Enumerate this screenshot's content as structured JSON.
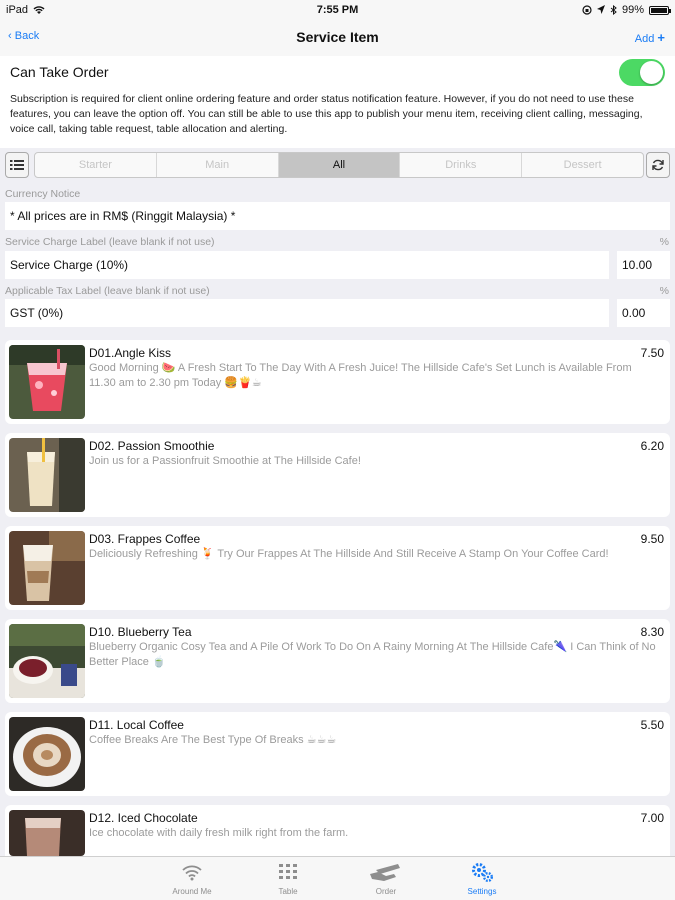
{
  "status_bar": {
    "carrier": "iPad",
    "time": "7:55 PM",
    "battery": "99%",
    "battery_level": 0.99
  },
  "nav": {
    "back_label": "Back",
    "title": "Service Item",
    "add_label": "Add"
  },
  "order": {
    "label": "Can Take Order",
    "enabled": true
  },
  "subscription_note": "Subscription is required for client online ordering feature and order status notification feature. However, if you do not need to use these features, you can leave the option off. You can still be able to use this app to publish your menu item, receiving client calling, messaging, voice call, taking table request, table allocation and alerting.",
  "segments": [
    {
      "label": "Starter",
      "active": false
    },
    {
      "label": "Main",
      "active": false
    },
    {
      "label": "All",
      "active": true
    },
    {
      "label": "Drinks",
      "active": false
    },
    {
      "label": "Dessert",
      "active": false
    }
  ],
  "currency": {
    "label": "Currency Notice",
    "value": "* All prices are in RM$ (Ringgit Malaysia) *"
  },
  "service_charge": {
    "label": "Service Charge Label (leave blank if not use)",
    "value": "Service Charge (10%)",
    "percent_symbol": "%",
    "percent_value": "10.00"
  },
  "tax": {
    "label": "Applicable Tax Label (leave blank if not use)",
    "value": "GST (0%)",
    "percent_symbol": "%",
    "percent_value": "0.00"
  },
  "items": [
    {
      "name": "D01.Angle Kiss",
      "price": "7.50",
      "description": "Good Morning 🍉 A Fresh Start To The Day With A Fresh Juice! The Hillside Cafe's Set Lunch is Available From 11.30 am to 2.30 pm Today 🍔🍟☕"
    },
    {
      "name": "D02. Passion Smoothie",
      "price": "6.20",
      "description": "Join us for a Passionfruit Smoothie at The Hillside Cafe!"
    },
    {
      "name": "D03. Frappes Coffee",
      "price": "9.50",
      "description": "Deliciously Refreshing 🍹 Try Our Frappes At The Hillside And Still Receive A Stamp On Your Coffee Card!"
    },
    {
      "name": "D10. Blueberry Tea",
      "price": "8.30",
      "description": "Blueberry Organic Cosy Tea and A Pile Of Work To Do On A Rainy Morning At The Hillside Cafe🌂 I Can Think of No Better Place 🍵"
    },
    {
      "name": "D11. Local Coffee",
      "price": "5.50",
      "description": "Coffee Breaks Are The Best Type Of Breaks ☕☕☕"
    },
    {
      "name": "D12. Iced Chocolate",
      "price": "7.00",
      "description": "Ice chocolate with daily fresh milk right from the farm."
    }
  ],
  "tabs": [
    {
      "label": "Around Me",
      "icon": "wifi-icon"
    },
    {
      "label": "Table",
      "icon": "grid-icon"
    },
    {
      "label": "Order",
      "icon": "hand-tray-icon"
    },
    {
      "label": "Settings",
      "icon": "gears-icon"
    }
  ],
  "colors": {
    "accent": "#1a7cf5",
    "toggle_on": "#4cd964"
  }
}
